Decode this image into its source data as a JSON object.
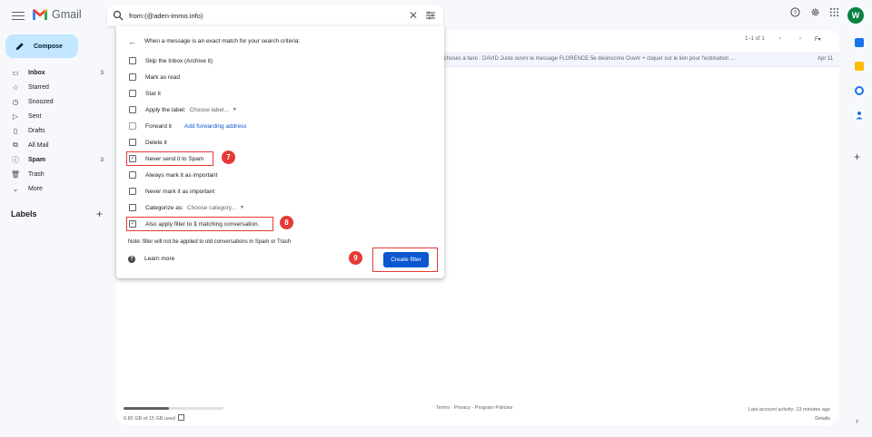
{
  "header": {
    "app_name": "Gmail",
    "search_query": "from:(@aden-immo.info)",
    "avatar_letter": "W"
  },
  "sidebar": {
    "compose_label": "Compose",
    "items": [
      {
        "label": "Inbox",
        "count": "3",
        "icon": "inbox-icon",
        "bold": true
      },
      {
        "label": "Starred",
        "count": "",
        "icon": "star-icon",
        "bold": false
      },
      {
        "label": "Snoozed",
        "count": "",
        "icon": "clock-icon",
        "bold": false
      },
      {
        "label": "Sent",
        "count": "",
        "icon": "send-icon",
        "bold": false
      },
      {
        "label": "Drafts",
        "count": "",
        "icon": "draft-icon",
        "bold": false
      },
      {
        "label": "All Mail",
        "count": "",
        "icon": "all-mail-icon",
        "bold": false
      },
      {
        "label": "Spam",
        "count": "3",
        "icon": "spam-icon",
        "bold": true
      },
      {
        "label": "Trash",
        "count": "",
        "icon": "trash-icon",
        "bold": false
      },
      {
        "label": "More",
        "count": "",
        "icon": "chevron-down-icon",
        "bold": false
      }
    ],
    "labels_heading": "Labels"
  },
  "main": {
    "pager_text": "1–1 of 1",
    "email_snippet": "s choses à faire : DAVID Juste ouvrir le message FLORENCE 5e désinscrire Ouvrir + cliquer sur le lien pour l'estimation ...",
    "email_date": "Apr 11",
    "storage_text": "6.82 GB of 15 GB used",
    "storage_used_fraction": 0.45,
    "footer_links": "Terms · Privacy · Program Policies",
    "activity_line1": "Last account activity: 13 minutes ago",
    "activity_line2": "Details"
  },
  "filter": {
    "title": "When a message is an exact match for your search criteria:",
    "options": {
      "skip_inbox": "Skip the Inbox (Archive it)",
      "mark_read": "Mark as read",
      "star_it": "Star it",
      "apply_label": "Apply the label:",
      "apply_label_value": "Choose label...",
      "forward_it": "Forward it",
      "add_forwarding": "Add forwarding address",
      "delete_it": "Delete it",
      "never_spam": "Never send it to Spam",
      "always_important": "Always mark it as important",
      "never_important": "Never mark it as important",
      "categorize": "Categorize as:",
      "categorize_value": "Choose category...",
      "also_apply_prefix": "Also apply filter to ",
      "also_apply_count": "1",
      "also_apply_suffix": " matching conversation."
    },
    "checked": {
      "never_spam": true,
      "also_apply": true
    },
    "note": "Note: filter will not be applied to old conversations in Spam or Trash",
    "learn_more": "Learn more",
    "create_button": "Create filter"
  },
  "annotations": {
    "badge_7": "7",
    "badge_8": "8",
    "badge_9": "9"
  },
  "colors": {
    "accent": "#0b57d0",
    "annotation_red": "#e53935",
    "compose_bg": "#c2e7ff"
  }
}
